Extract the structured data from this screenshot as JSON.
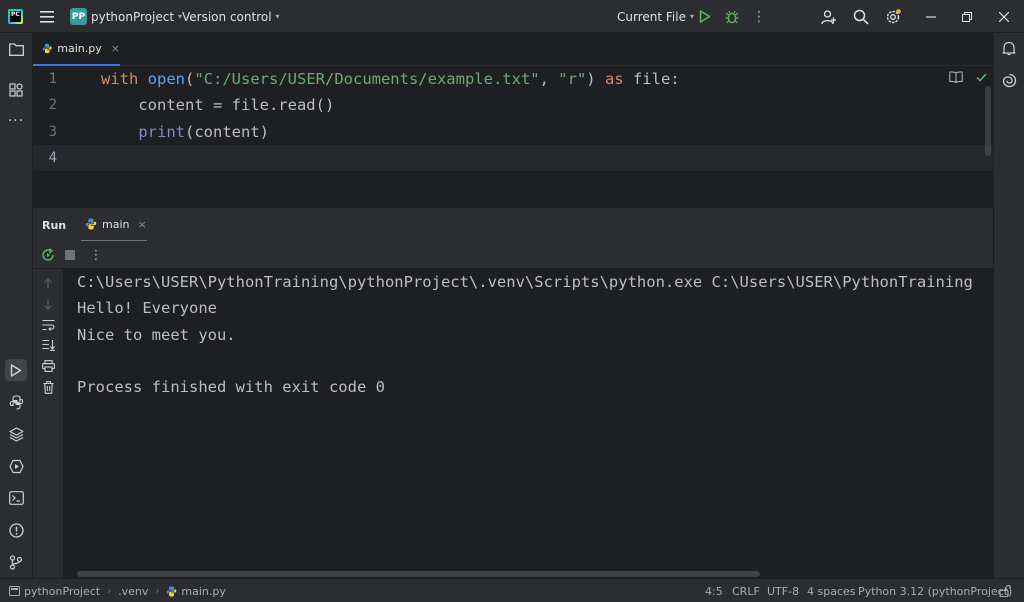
{
  "titlebar": {
    "project_badge": "PP",
    "project_name": "pythonProject",
    "vcs": "Version control",
    "run_config": "Current File"
  },
  "editor": {
    "tab_label": "main.py",
    "tab_close": "×",
    "line_numbers": [
      "1",
      "2",
      "3",
      "4"
    ],
    "code": {
      "l1": {
        "kw_with": "with",
        "fn_open": "open",
        "p1": "(",
        "s1": "\"C:/Users/USER/Documents/example.txt\"",
        "p2": ", ",
        "s2": "\"r\"",
        "p3": ") ",
        "kw_as": "as",
        "p4": " file:"
      },
      "l2": {
        "text": "    content = file.read()"
      },
      "l3": {
        "indent": "    ",
        "bi_print": "print",
        "rest": "(content)"
      }
    }
  },
  "run_panel": {
    "title": "Run",
    "tab_label": "main",
    "tab_close": "×",
    "console": [
      "C:\\Users\\USER\\PythonTraining\\pythonProject\\.venv\\Scripts\\python.exe C:\\Users\\USER\\PythonTraining",
      "Hello! Everyone",
      "Nice to meet you.",
      "",
      "Process finished with exit code 0"
    ]
  },
  "statusbar": {
    "breadcrumb_project": "pythonProject",
    "breadcrumb_venv": ".venv",
    "breadcrumb_file": "main.py",
    "sep": "›",
    "caret_pos": "4:5",
    "line_sep": "CRLF",
    "encoding": "UTF-8",
    "indent": "4 spaces",
    "interpreter": "Python 3.12 (pythonProject)"
  },
  "colors": {
    "accent": "#3574f0",
    "run_green": "#5fb865",
    "project_badge": "#3a9b9a",
    "background": "#1e1f22",
    "chrome": "#2b2d30"
  }
}
